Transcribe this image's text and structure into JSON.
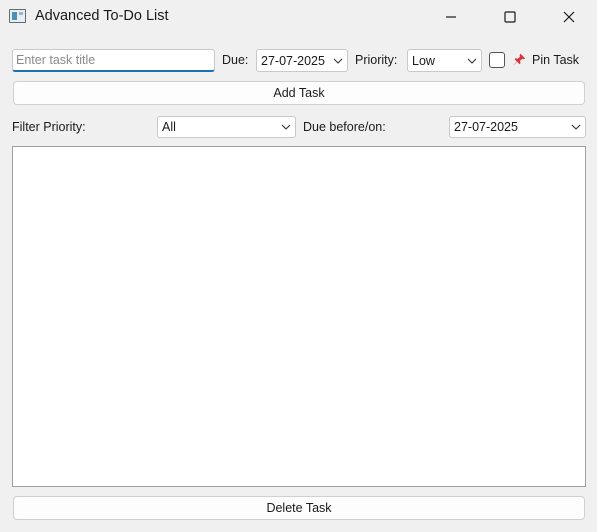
{
  "window": {
    "title": "Advanced To-Do List",
    "app_icon": "window-app-icon",
    "controls": [
      "minimize-icon",
      "maximize-icon",
      "close-icon"
    ]
  },
  "add_form": {
    "title_placeholder": "Enter task title",
    "title_value": "",
    "due_label": "Due:",
    "due_value": "27-07-2025",
    "priority_label": "Priority:",
    "priority_value": "Low",
    "pin_checked": false,
    "pin_icon": "pushpin-icon",
    "pin_label": "Pin Task",
    "add_button": "Add Task"
  },
  "filter": {
    "priority_label": "Filter Priority:",
    "priority_value": "All",
    "due_label": "Due before/on:",
    "due_value": "27-07-2025"
  },
  "tasks": [],
  "delete_button": "Delete Task",
  "colors": {
    "focus_underline": "#1d6fb8",
    "pin_red": "#d9343c",
    "window_bg": "#f0f0f0"
  }
}
